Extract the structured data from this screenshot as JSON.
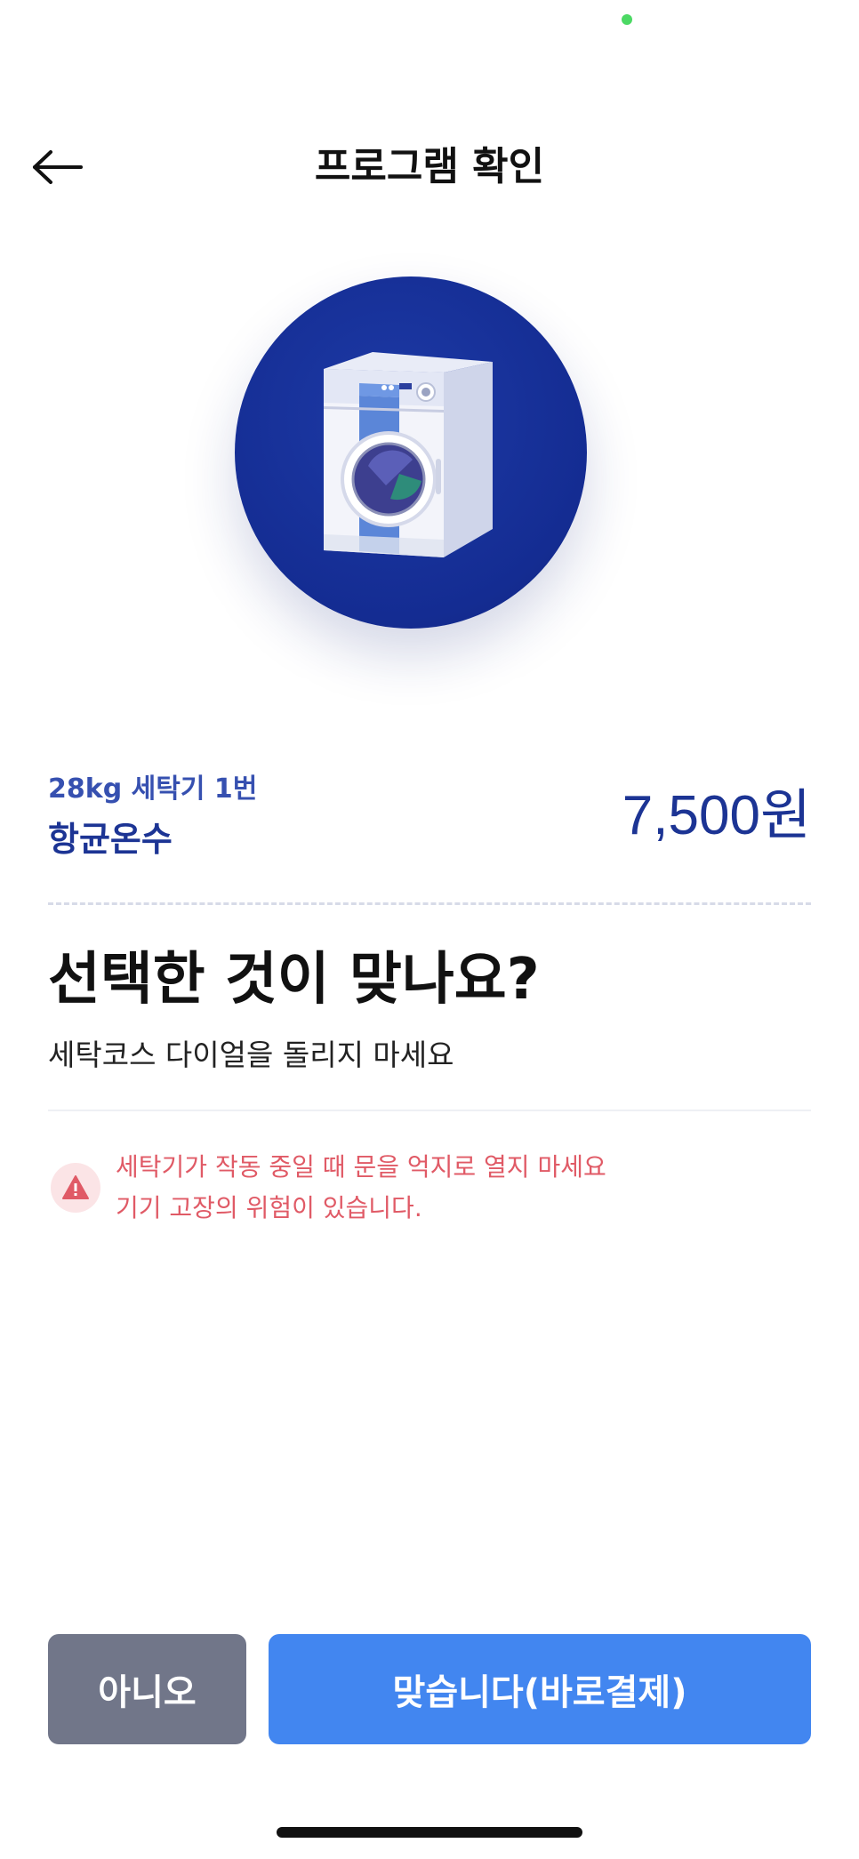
{
  "header": {
    "title": "프로그램 확인",
    "back_icon": "arrow-left-icon"
  },
  "hero": {
    "icon": "washing-machine-icon",
    "accent": "#142c92"
  },
  "product": {
    "machine": "28kg 세탁기 1번",
    "course": "항균온수",
    "price": "7,500원"
  },
  "confirm": {
    "question": "선택한 것이 맞나요?",
    "instruction": "세탁코스 다이얼을 돌리지 마세요"
  },
  "warning": {
    "icon": "warning-triangle-icon",
    "line1": "세탁기가 작동 중일 때 문을 억지로 열지 마세요",
    "line2": "기기 고장의 위험이 있습니다."
  },
  "buttons": {
    "no_label": "아니오",
    "yes_label": "맞습니다(바로결제)"
  },
  "colors": {
    "primary": "#4286f0",
    "secondary": "#717689",
    "brand_dark": "#1c3494",
    "warning": "#e05a66"
  }
}
